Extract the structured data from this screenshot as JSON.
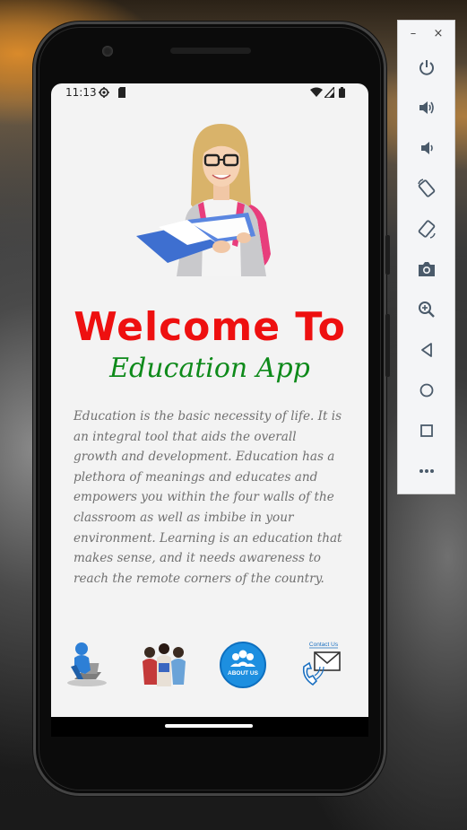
{
  "status_bar": {
    "time": "11:13",
    "icons": [
      "settings-icon",
      "sd-card-icon",
      "wifi-icon",
      "signal-icon",
      "battery-icon"
    ]
  },
  "app": {
    "hero_image": "student-with-book-illustration",
    "welcome_title": "Welcome To",
    "app_name": "Education App",
    "description": "Education is the basic necessity of life. It is an integral tool that aids the overall growth and development. Education has a plethora of meanings and educates and empowers you within the four walls of the classroom as well as imbibe in your environment. Learning is an education that makes sense, and it needs awareness to reach the remote corners of the country.",
    "bottom_buttons": [
      {
        "icon": "e-learning-icon"
      },
      {
        "icon": "students-group-icon"
      },
      {
        "icon": "about-us-icon",
        "label": "ABOUT US"
      },
      {
        "icon": "contact-us-icon",
        "label": "Contact Us"
      }
    ]
  },
  "colors": {
    "welcome_red": "#ee1010",
    "app_name_green": "#0e8a1a",
    "description_gray": "#707070",
    "about_blue": "#1d8fe0"
  },
  "emulator_panel": {
    "window_controls": [
      "minimize-icon",
      "close-icon"
    ],
    "tools": [
      "power-icon",
      "volume-up-icon",
      "volume-down-icon",
      "rotate-left-icon",
      "rotate-right-icon",
      "camera-icon",
      "zoom-icon",
      "back-icon",
      "home-icon",
      "overview-icon",
      "more-icon"
    ]
  }
}
